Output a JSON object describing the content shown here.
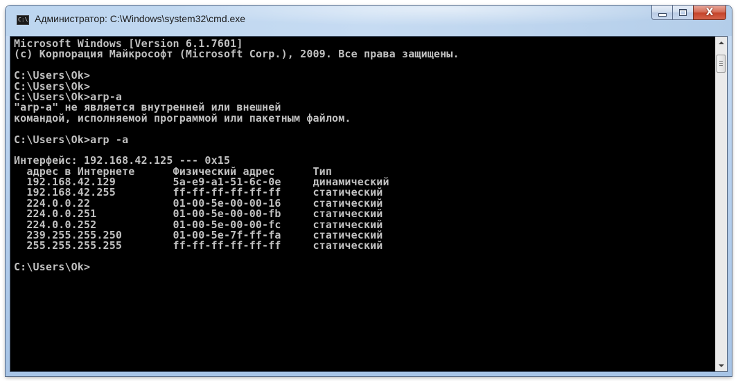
{
  "window": {
    "title": "Администратор: C:\\Windows\\system32\\cmd.exe",
    "icon": "cmd-icon",
    "icon_text": "C:\\"
  },
  "caption_buttons": {
    "minimize_icon": "minimize-icon",
    "maximize_icon": "maximize-icon",
    "close_icon": "close-icon",
    "close_glyph": "X"
  },
  "console": {
    "lines": [
      "Microsoft Windows [Version 6.1.7601]",
      "(c) Корпорация Майкрософт (Microsoft Corp.), 2009. Все права защищены.",
      "",
      "C:\\Users\\Ok>",
      "C:\\Users\\Ok>",
      "C:\\Users\\Ok>arp-a",
      "\"arp-a\" не является внутренней или внешней",
      "командой, исполняемой программой или пакетным файлом.",
      "",
      "C:\\Users\\Ok>arp -a",
      "",
      "Интерфейс: 192.168.42.125 --- 0x15",
      "  адрес в Интернете      Физический адрес      Тип",
      "  192.168.42.129         5a-e9-a1-51-6c-0e     динамический",
      "  192.168.42.255         ff-ff-ff-ff-ff-ff     статический",
      "  224.0.0.22             01-00-5e-00-00-16     статический",
      "  224.0.0.251            01-00-5e-00-00-fb     статический",
      "  224.0.0.252            01-00-5e-00-00-fc     статический",
      "  239.255.255.250        01-00-5e-7f-ff-fa     статический",
      "  255.255.255.255        ff-ff-ff-ff-ff-ff     статический",
      "",
      "C:\\Users\\Ok>"
    ]
  },
  "colors": {
    "console_background": "#000000",
    "console_text": "#c0c0c0",
    "close_button": "#c5442a"
  }
}
